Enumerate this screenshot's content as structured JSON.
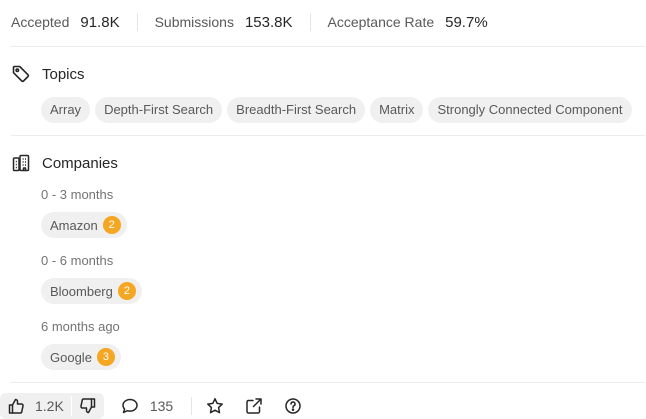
{
  "stats": [
    {
      "label": "Accepted",
      "value": "91.8K"
    },
    {
      "label": "Submissions",
      "value": "153.8K"
    },
    {
      "label": "Acceptance Rate",
      "value": "59.7%"
    }
  ],
  "topics": {
    "title": "Topics",
    "icon": "tag-icon",
    "tags": [
      "Array",
      "Depth-First Search",
      "Breadth-First Search",
      "Matrix",
      "Strongly Connected Component"
    ]
  },
  "companies": {
    "title": "Companies",
    "icon": "building-icon",
    "groups": [
      {
        "period": "0 - 3 months",
        "company": "Amazon",
        "count": "2"
      },
      {
        "period": "0 - 6 months",
        "company": "Bloomberg",
        "count": "2"
      },
      {
        "period": "6 months ago",
        "company": "Google",
        "count": "3"
      }
    ]
  },
  "footer": {
    "likes": "1.2K",
    "comments": "135"
  },
  "colors": {
    "badge": "#f5a623",
    "chip_bg": "#f0f0f0",
    "text": "#262626",
    "muted": "#595959"
  }
}
